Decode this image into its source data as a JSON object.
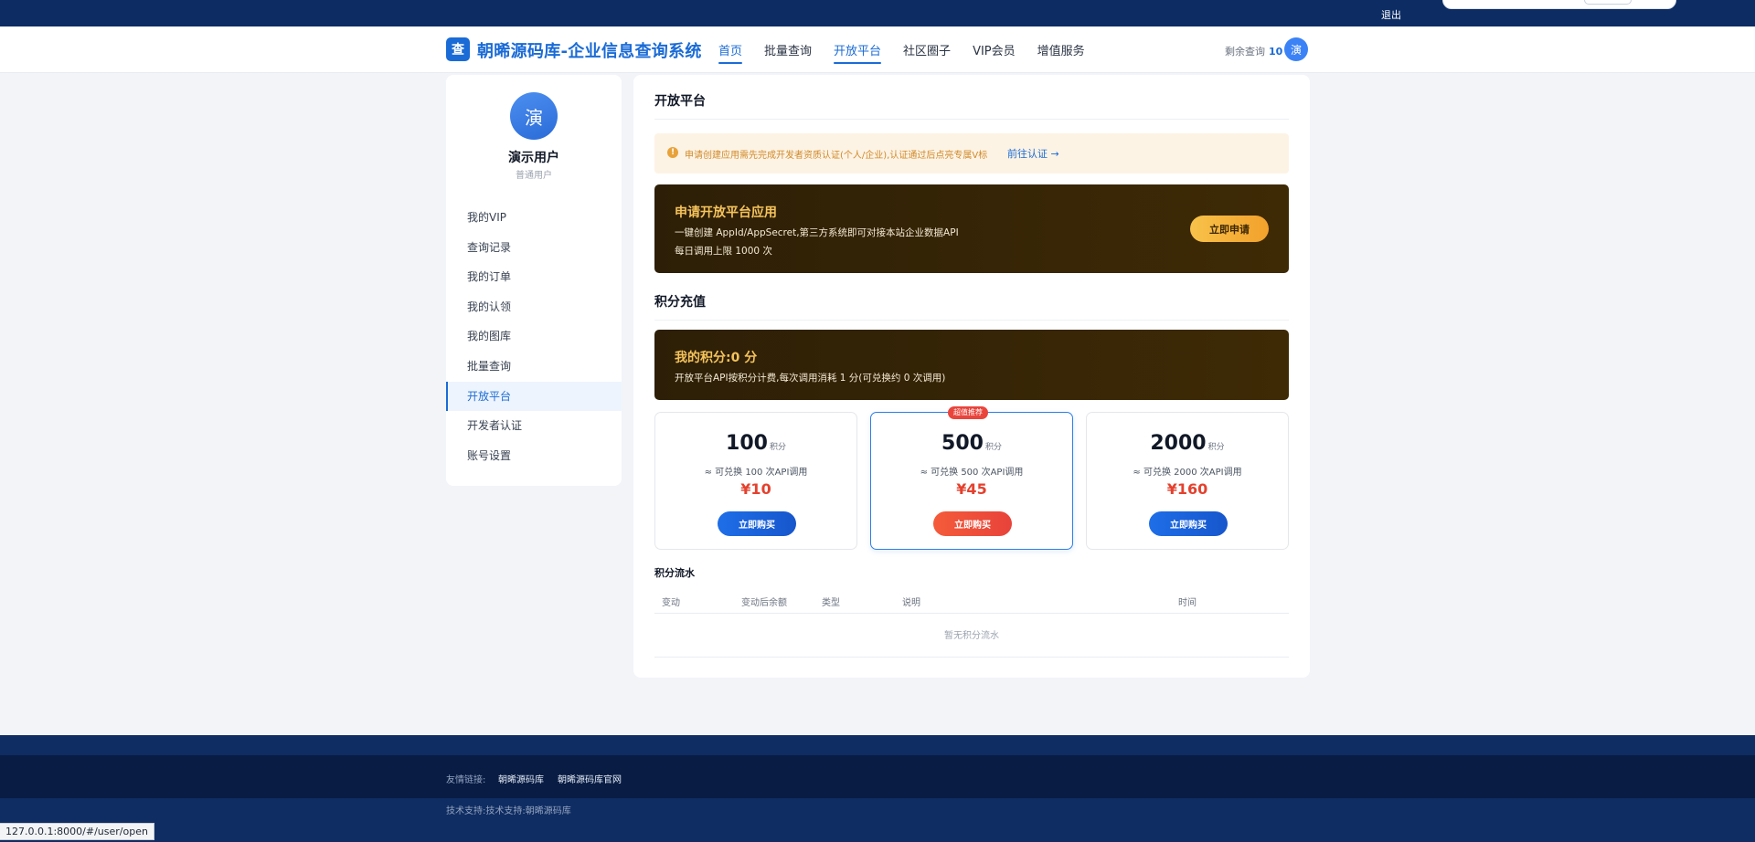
{
  "topbar": {
    "logout": "退出"
  },
  "header": {
    "logo_glyph": "查",
    "site_title": "朝晞源码库-企业信息查询系统",
    "nav": [
      "首页",
      "批量查询",
      "开放平台",
      "社区圈子",
      "VIP会员",
      "增值服务"
    ],
    "remain_label": "剩余查询",
    "remain_count": "10",
    "avatar": "演"
  },
  "sidebar": {
    "avatar": "演",
    "username": "演示用户",
    "role": "普通用户",
    "menu": [
      "我的VIP",
      "查询记录",
      "我的订单",
      "我的认领",
      "我的图库",
      "批量查询",
      "开放平台",
      "开发者认证",
      "账号设置"
    ]
  },
  "main": {
    "title": "开放平台",
    "notice": {
      "text": "申请创建应用需先完成开发者资质认证(个人/企业),认证通过后点亮专属V标",
      "link": "前往认证 →"
    },
    "apply_card": {
      "title": "申请开放平台应用",
      "desc1": "一键创建 AppId/AppSecret,第三方系统即可对接本站企业数据API",
      "desc2": "每日调用上限 1000 次",
      "button": "立即申请"
    },
    "points_title": "积分充值",
    "points_card": {
      "title": "我的积分:0 分",
      "desc": "开放平台API按积分计费,每次调用消耗 1 分(可兑换约 0 次调用)"
    },
    "packages": [
      {
        "amount": "100",
        "unit": "积分",
        "desc": "≈ 可兑换 100 次API调用",
        "price": "¥10",
        "button": "立即购买",
        "badge": ""
      },
      {
        "amount": "500",
        "unit": "积分",
        "desc": "≈ 可兑换 500 次API调用",
        "price": "¥45",
        "button": "立即购买",
        "badge": "超值推荐"
      },
      {
        "amount": "2000",
        "unit": "积分",
        "desc": "≈ 可兑换 2000 次API调用",
        "price": "¥160",
        "button": "立即购买",
        "badge": ""
      }
    ],
    "flow": {
      "title": "积分流水",
      "columns": [
        "变动",
        "变动后余额",
        "类型",
        "说明",
        "时间"
      ],
      "empty": "暂无积分流水"
    }
  },
  "footer": {
    "links_label": "友情链接:",
    "links": [
      "朝晞源码库",
      "朝晞源码库官网"
    ],
    "support": "技术支持:技术支持:朝晞源码库"
  },
  "statusbar": {
    "url": "127.0.0.1:8000/#/user/open"
  }
}
